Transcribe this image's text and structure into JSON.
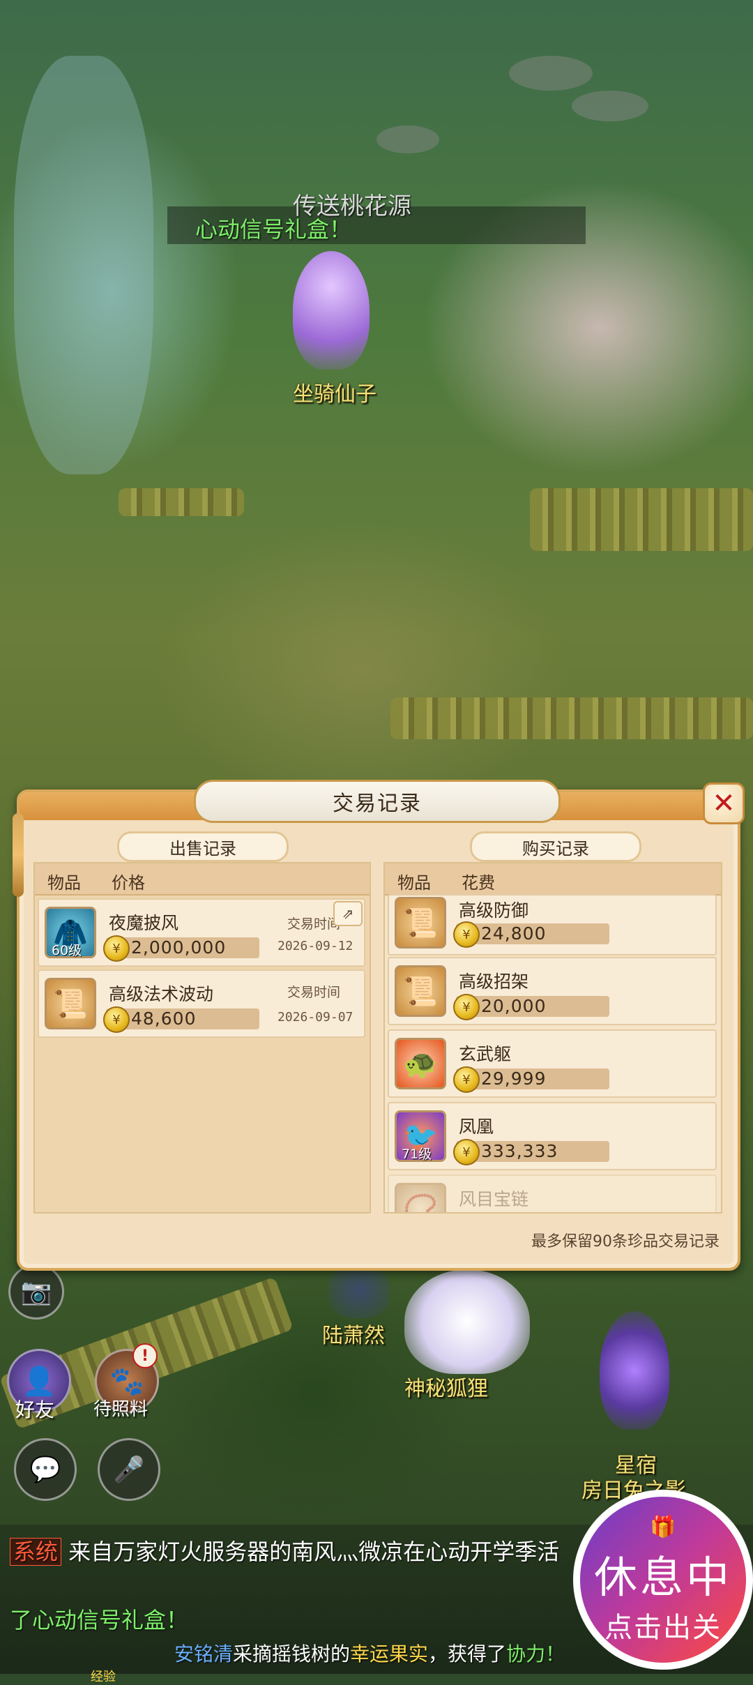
{
  "scene": {
    "portal_label": "传送桃花源",
    "banner_text": "心动信号礼盒！",
    "npc_names": {
      "mount_fairy": "坐骑仙子",
      "lu_xiaoran": "陆萧然",
      "mystic_fox": "神秘狐狸",
      "star_title": "星宿",
      "star_name": "房日兔之影"
    }
  },
  "dialog": {
    "title": "交易记录",
    "close_symbol": "✕",
    "sell": {
      "title": "出售记录",
      "col_item": "物品",
      "col_price": "价格",
      "time_label": "交易时间",
      "rows": [
        {
          "name": "夜魔披风",
          "level": "60级",
          "price": "2,000,000",
          "date": "2026-09-12",
          "icon": "cloak-icon"
        },
        {
          "name": "高级法术波动",
          "level": "",
          "price": "48,600",
          "date": "2026-09-07",
          "icon": "scroll-icon"
        }
      ]
    },
    "buy": {
      "title": "购买记录",
      "col_item": "物品",
      "col_cost": "花费",
      "rows": [
        {
          "name": "高级防御",
          "level": "",
          "price": "24,800",
          "icon": "scroll-icon"
        },
        {
          "name": "高级招架",
          "level": "",
          "price": "20,000",
          "icon": "scroll-icon"
        },
        {
          "name": "玄武躯",
          "level": "",
          "price": "29,999",
          "icon": "pet-face-icon"
        },
        {
          "name": "凤凰",
          "level": "71级",
          "price": "333,333",
          "icon": "phoenix-icon"
        },
        {
          "name": "风目宝链",
          "level": "",
          "price": "",
          "icon": "necklace-icon"
        }
      ]
    },
    "footer_note": "最多保留90条珍品交易记录"
  },
  "hud": {
    "friends_label": "好友",
    "pending_label": "待照料",
    "badge_symbol": "!"
  },
  "chat": {
    "system_tag": "系统",
    "line1": "来自万家灯火服务器的南风灬微凉在心动开学季活",
    "line2": "了心动信号礼盒！",
    "line3_name": "安铭清",
    "line3_action": "采摘摇钱树的",
    "line3_item": "幸运果实",
    "line3_rest": "，获得了",
    "line3_reward": "协力！",
    "exp_label": "经验"
  },
  "rest_badge": {
    "line1": "休息中",
    "line2": "点击出关"
  },
  "colors": {
    "dialog_bg": "#f3dfbf",
    "dialog_border": "#d9a85a",
    "close_red": "#c41a1a",
    "npc_name_yellow": "#f4e27a",
    "chat_highlight": "#7ef06a"
  }
}
